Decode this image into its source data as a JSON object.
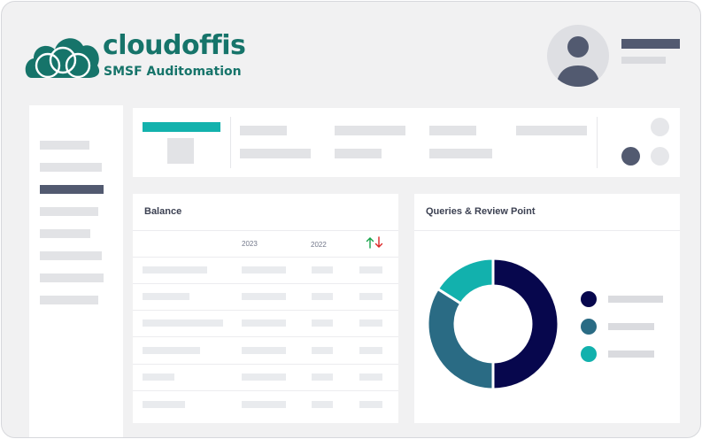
{
  "brand": {
    "name": "cloudoffis",
    "tagline": "SMSF Auditomation",
    "color": "#16746a"
  },
  "user": {
    "avatar_icon": "user-avatar-icon"
  },
  "sidebar": {
    "item_count": 8,
    "active_index": 2
  },
  "balance": {
    "title": "Balance",
    "columns": [
      "2023",
      "2022"
    ],
    "change_icon": "up-down-arrows-icon",
    "rows": 6
  },
  "queries": {
    "title": "Queries & Review Point",
    "chart_data": {
      "type": "pie",
      "donut": true,
      "title": "",
      "slices": [
        {
          "name": "",
          "value": 50,
          "color": "#07074d"
        },
        {
          "name": "",
          "value": 34,
          "color": "#2a6b84"
        },
        {
          "name": "",
          "value": 16,
          "color": "#12b1ad"
        }
      ]
    }
  },
  "colors": {
    "accent": "#13b2ad",
    "dark": "#525a70",
    "placeholder": "#e2e3e6"
  }
}
